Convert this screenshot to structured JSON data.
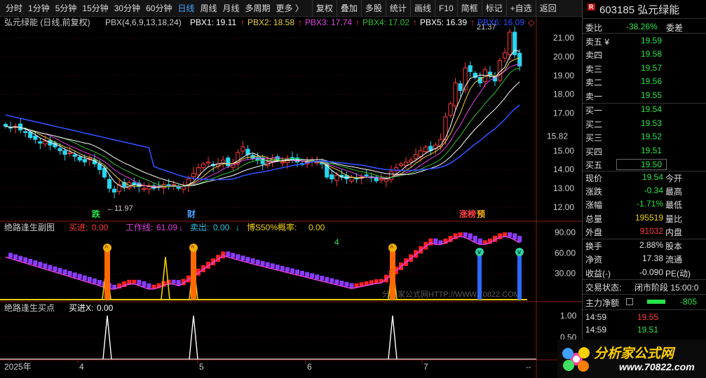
{
  "toolbar": {
    "periods": [
      "分时",
      "1分钟",
      "5分钟",
      "15分钟",
      "30分钟",
      "60分钟",
      "日线",
      "周线",
      "月线",
      "多周期",
      "更多 〉"
    ],
    "active_period": "日线",
    "tools": [
      "复权",
      "叠加",
      "多股",
      "统计",
      "画线",
      "F10",
      "简框",
      "标记",
      "+自选",
      "返回"
    ]
  },
  "main": {
    "title": "弘元绿能 (日线,前复权)",
    "ind_name": "PBX(4,6,9,13,18,24)",
    "pbx": [
      {
        "label": "PBX1:",
        "value": "19.11",
        "arrow": "↑",
        "color": "#ffffff"
      },
      {
        "label": "PBX2:",
        "value": "18.58",
        "arrow": "↑",
        "color": "#e8d040"
      },
      {
        "label": "PBX3:",
        "value": "17.74",
        "arrow": "↑",
        "color": "#e040e0"
      },
      {
        "label": "PBX4:",
        "value": "17.02",
        "arrow": "↑",
        "color": "#30c030"
      },
      {
        "label": "PBX5:",
        "value": "16.39",
        "arrow": "↑",
        "color": "#ffffff"
      },
      {
        "label": "PBX6:",
        "value": "16.09",
        "arrow": "◇",
        "color": "#3050ff"
      }
    ],
    "price_ticks": [
      "21.00",
      "20.00",
      "19.00",
      "18.00",
      "17.00",
      "16.00",
      "15.00",
      "14.00",
      "13.00",
      "12.00"
    ],
    "current_price_tag": "15.82",
    "high_label": "21.37",
    "low_label": "11.97",
    "tags": [
      {
        "text": "跌",
        "color": "#27e34a"
      },
      {
        "text": "财",
        "color": "#4aa3ff"
      },
      {
        "text": "涨榜",
        "color": "#ff4040"
      },
      {
        "text": "预",
        "color": "#ffb000"
      }
    ]
  },
  "sub1": {
    "title": "绝路逢生副图",
    "fields": [
      {
        "label": "买进:",
        "value": "0.00",
        "color": "#ff3b3b"
      },
      {
        "label": "工作线:",
        "value": "61.09",
        "arrow": "↓",
        "color": "#e040e0"
      },
      {
        "label": "卖出:",
        "value": "0.00",
        "arrow": "↓",
        "color": "#30c0e0"
      },
      {
        "label": "博S50%概率:",
        "value": "0.00",
        "color": "#f0d000"
      }
    ],
    "ticks": [
      "90.00",
      "60.00",
      "30.00"
    ],
    "marker": "4",
    "watermark": "分析家公式网HTTP://WWW.70822.COM"
  },
  "sub2": {
    "title": "绝路逢生买点",
    "fields": [
      {
        "label": "买进X:",
        "value": "0.00",
        "color": "#ffffff"
      }
    ],
    "ticks": [
      "1.00",
      "0.50"
    ]
  },
  "xaxis": {
    "labels": [
      "2025年",
      "4",
      "5",
      "6",
      "7"
    ],
    "end_marker": "--",
    "cut_label": "E"
  },
  "quote": {
    "badge": "R",
    "code_name": "603185 弘元绿能",
    "webi_label": "委比",
    "webi_value": "-38.26%",
    "weicha_label": "委差",
    "asks": [
      {
        "label": "卖五 ¥",
        "price": "19.59"
      },
      {
        "label": "卖四",
        "price": "19.58"
      },
      {
        "label": "卖三",
        "price": "19.57"
      },
      {
        "label": "卖二",
        "price": "19.56"
      },
      {
        "label": "卖一",
        "price": "19.55"
      }
    ],
    "bids": [
      {
        "label": "买一",
        "price": "19.54"
      },
      {
        "label": "买二",
        "price": "19.53"
      },
      {
        "label": "买三",
        "price": "19.52"
      },
      {
        "label": "买四",
        "price": "19.51"
      },
      {
        "label": "买五",
        "price": "19.50"
      }
    ],
    "stats": [
      {
        "label": "现价",
        "value": "19.54",
        "color": "#27e34a",
        "right": "今开"
      },
      {
        "label": "涨跌",
        "value": "-0.34",
        "color": "#27e34a",
        "right": "最高"
      },
      {
        "label": "涨幅",
        "value": "-1.71%",
        "color": "#27e34a",
        "right": "最低"
      },
      {
        "label": "总量",
        "value": "195519",
        "color": "#f0d000",
        "right": "量比"
      },
      {
        "label": "外盘",
        "value": "91032",
        "color": "#ff3b3b",
        "right": "内盘"
      }
    ],
    "stats2": [
      {
        "label": "换手",
        "value": "2.88%",
        "right": "股本"
      },
      {
        "label": "净资",
        "value": "17.38",
        "right": "流通"
      },
      {
        "label": "收益(-)",
        "value": "-0.090",
        "right": "PE(动)"
      }
    ],
    "status_label": "交易状态:",
    "status_value": "闭市阶段 15:00:0",
    "main_net_label": "主力净额",
    "main_net_value": "-805",
    "ticks_list": [
      {
        "time": "14:59",
        "price": "19.55"
      },
      {
        "time": "14:59",
        "price": "19.51"
      }
    ]
  },
  "logo": {
    "text": "分析家公式网",
    "url": "www.70822.com"
  },
  "colors": {
    "up": "#ff3b3b",
    "down": "#27e34a",
    "cyan": "#00e0e0",
    "accent": "#4aa3ff"
  }
}
